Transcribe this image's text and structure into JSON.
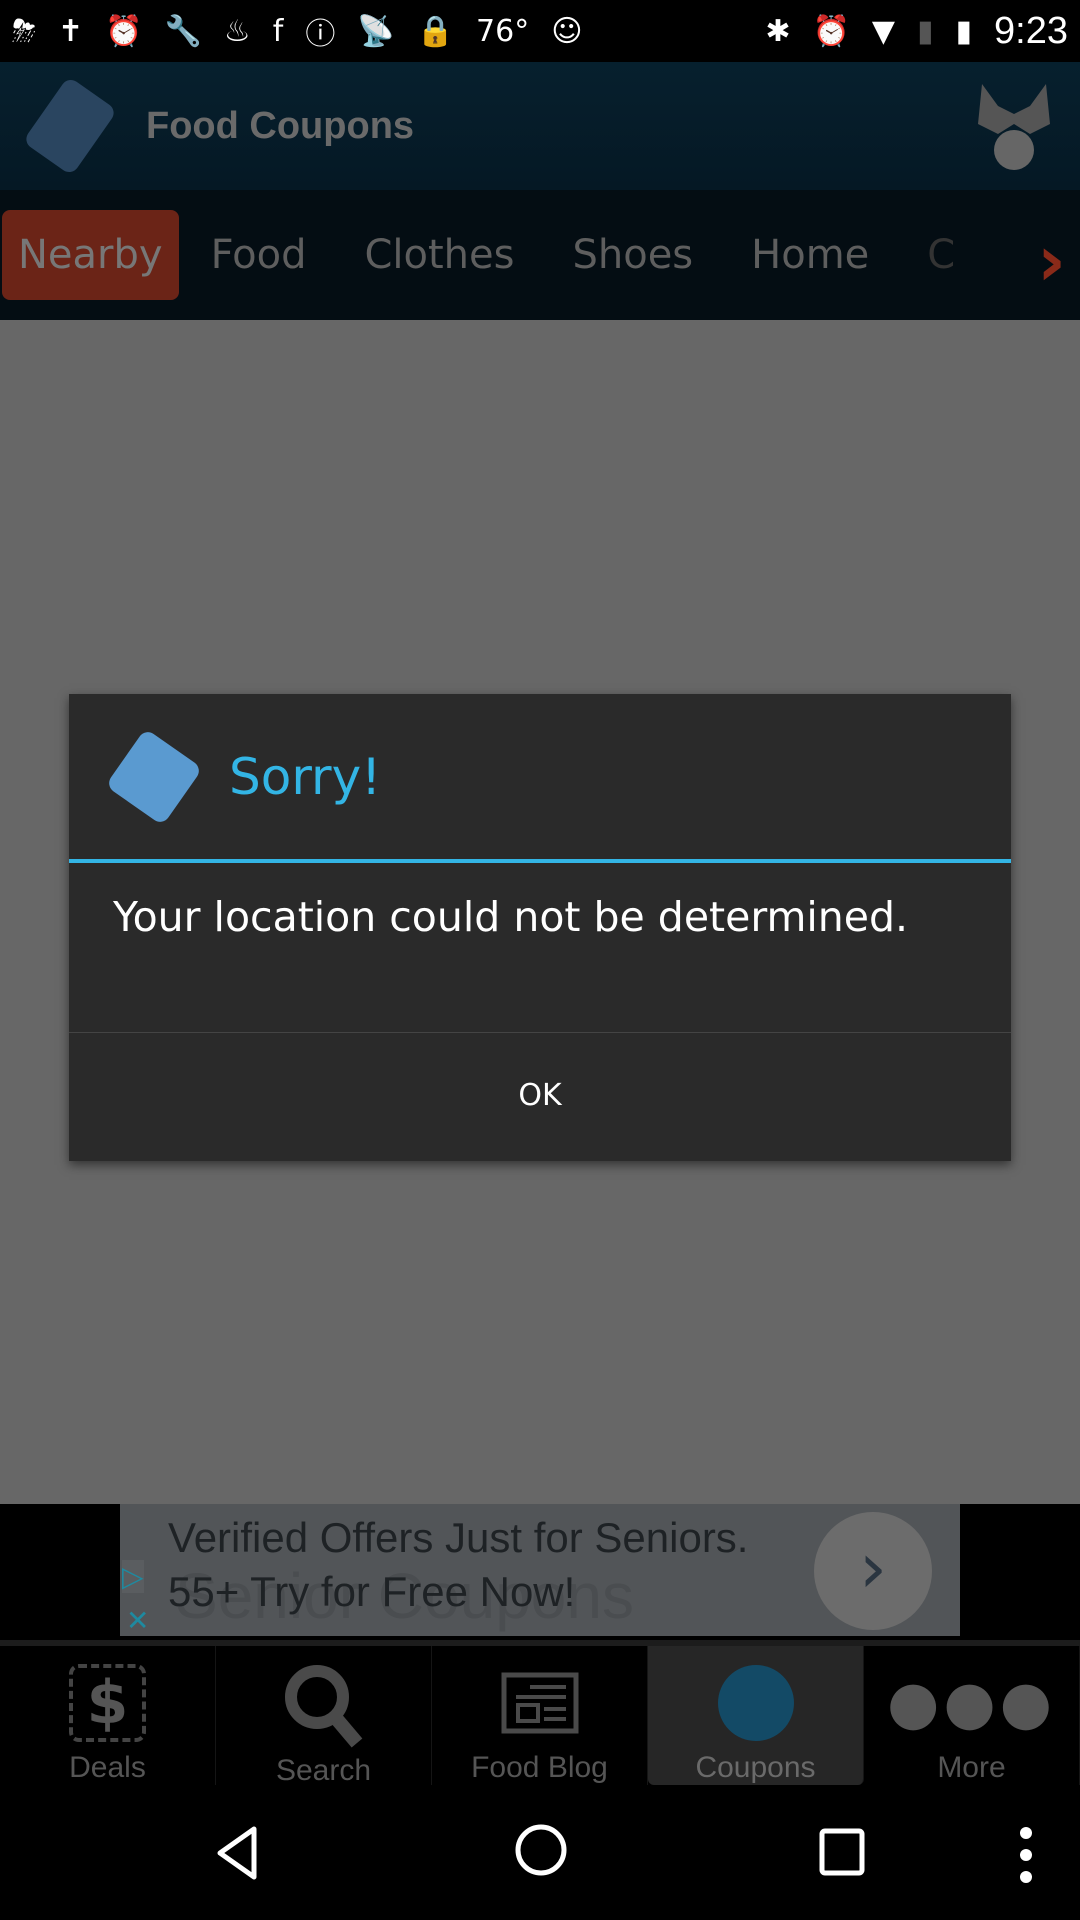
{
  "status_bar": {
    "temperature": "76°",
    "time": "9:23"
  },
  "header": {
    "title": "Food Coupons"
  },
  "tabs": [
    {
      "label": "Nearby",
      "active": true
    },
    {
      "label": "Food"
    },
    {
      "label": "Clothes"
    },
    {
      "label": "Shoes"
    },
    {
      "label": "Home"
    },
    {
      "label": "C"
    }
  ],
  "ad": {
    "line1": "Verified Offers Just for Seniors.",
    "line2": "55+ Try for Free Now!",
    "ghost": "Senior Coupons"
  },
  "bottom_nav": [
    {
      "label": "Deals",
      "icon": "dollar-icon"
    },
    {
      "label": "Search",
      "icon": "search-icon"
    },
    {
      "label": "Food Blog",
      "icon": "newspaper-icon"
    },
    {
      "label": "Coupons",
      "icon": "globe-icon",
      "active": true
    },
    {
      "label": "More",
      "icon": "more-icon"
    }
  ],
  "dialog": {
    "title": "Sorry!",
    "message": "Your location could not be determined.",
    "ok_label": "OK"
  },
  "colors": {
    "accent": "#33b5e5",
    "active_tab": "#6b2417"
  }
}
